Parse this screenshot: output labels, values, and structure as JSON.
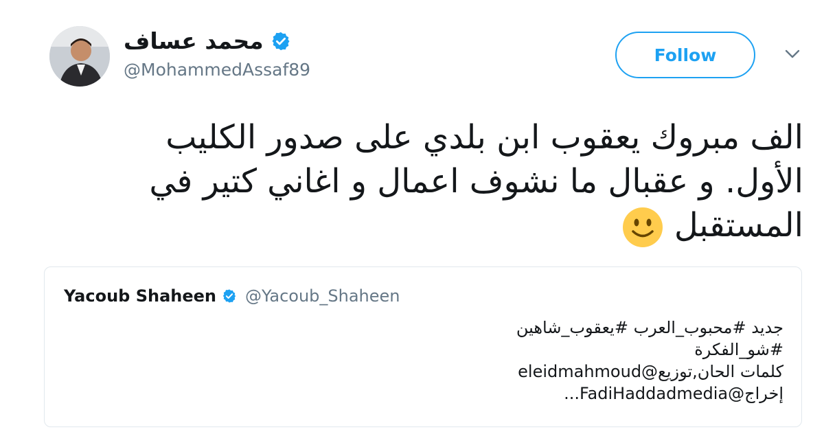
{
  "author": {
    "display_name": "محمد عساف",
    "handle": "@MohammedAssaf89",
    "verified_icon": "verified-badge-icon",
    "avatar_icon": "avatar"
  },
  "actions": {
    "follow_label": "Follow",
    "menu_icon": "chevron-down-icon"
  },
  "tweet": {
    "lines": [
      "الف مبروك يعقوب ابن بلدي على  صدور الكليب",
      "الأول. و عقبال ما نشوف اعمال و اغاني كتير في",
      "المستقبل"
    ],
    "emoji": "slightly-smiling-face-icon"
  },
  "quoted_tweet": {
    "display_name": "Yacoub Shaheen",
    "handle": "@Yacoub_Shaheen",
    "lines": [
      "جديد #محبوب_العرب #يعقوب_شاهين",
      "#شو_الفكرة",
      "كلمات الحان,توزيع@eleidmahmoud",
      "إخراج@FadiHaddadmedia..."
    ]
  },
  "colors": {
    "accent": "#1da1f2",
    "text": "#14171a",
    "secondary": "#657786",
    "border": "#e1e8ed"
  }
}
